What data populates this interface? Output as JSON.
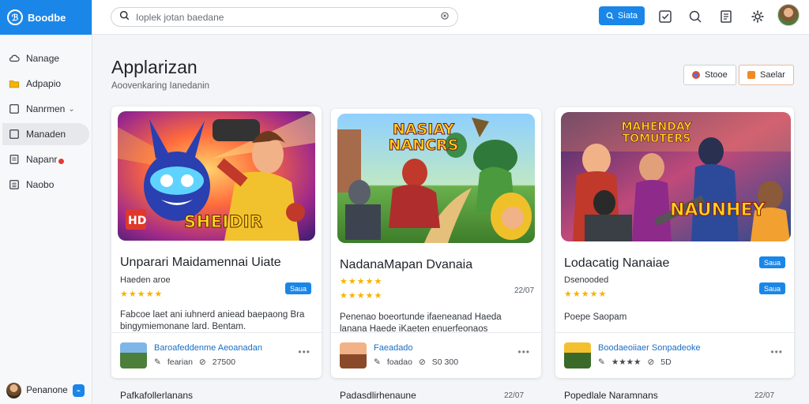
{
  "brand": {
    "logo_glyph": "ℬ",
    "name": "Boodbe"
  },
  "sidebar": {
    "items": [
      {
        "label": "Nanage",
        "icon": "cloud-icon"
      },
      {
        "label": "Adpapio",
        "icon": "folder-icon"
      },
      {
        "label": "Nanrmen",
        "icon": "square-icon",
        "has_chevron": true
      },
      {
        "label": "Manaden",
        "icon": "square-icon",
        "active": true
      },
      {
        "label": "Napanr",
        "icon": "doc-icon",
        "has_badge": true
      },
      {
        "label": "Naobo",
        "icon": "list-icon"
      }
    ],
    "chevron": "⌄",
    "user_name": "Penanone",
    "user_badge": "⌁"
  },
  "topbar": {
    "search_placeholder": "Ioplek jotan baedane",
    "button_label": "Siata",
    "icons": [
      "checklist-icon",
      "search-zoom-icon",
      "document-icon",
      "gear-icon"
    ]
  },
  "main": {
    "title": "Applarizan",
    "subtitle": "Aoovenkaring Ianedanin",
    "header_buttons": [
      {
        "label": "Stooe",
        "dot_color": "#e04b3a"
      },
      {
        "label": "Saelar",
        "dot_color": "#f08a24"
      }
    ]
  },
  "cards": [
    {
      "title": "Unparari Maidamennai Uiate",
      "subtitle": "Haeden aroe",
      "stars": "★★★★★",
      "badge": "Saua",
      "count": "",
      "description": "Fabcoe laet ani iuhnerd aniead baepaong Bra bingymiemonane lard. Bentam.",
      "art_text": "SHEIDIR",
      "art_badge": "HD",
      "footer": {
        "name": "Baroafeddenme Aeoanadan",
        "meta1": "fearian",
        "meta2": "27500"
      }
    },
    {
      "title": "NadanaMapan Dvanaia",
      "subtitle": "",
      "stars": "★★★★★",
      "badge": "",
      "count": "22/07",
      "description": "Penenao boeortunde ifaeneanad Haeda lanana Haede iKaeten enuerfeonaos",
      "art_text": "NASIAY NANCRS",
      "art_badge": "",
      "footer": {
        "name": "Faeadado",
        "meta1": "foadao",
        "meta2": "S0 300"
      }
    },
    {
      "title": "Lodacatig Nanaiae",
      "subtitle": "Dsenooded",
      "stars": "★★★★★",
      "badge": "Saua",
      "count": "",
      "description": "Poepe Saopam",
      "art_text": "NAUNHEY",
      "art_top": "MAHENDAY TOMUTERS",
      "art_badge": "",
      "footer": {
        "name": "Boodaeoiiaer Sonpadeoke",
        "meta1": "★★★★",
        "meta2": "5D"
      }
    }
  ],
  "below": [
    {
      "title": "Pafkafollerlanans",
      "count": ""
    },
    {
      "title": "Padasdlirhenaune",
      "count": "22/07"
    },
    {
      "title": "Popedlale Naramnans",
      "count": "22/07"
    }
  ]
}
